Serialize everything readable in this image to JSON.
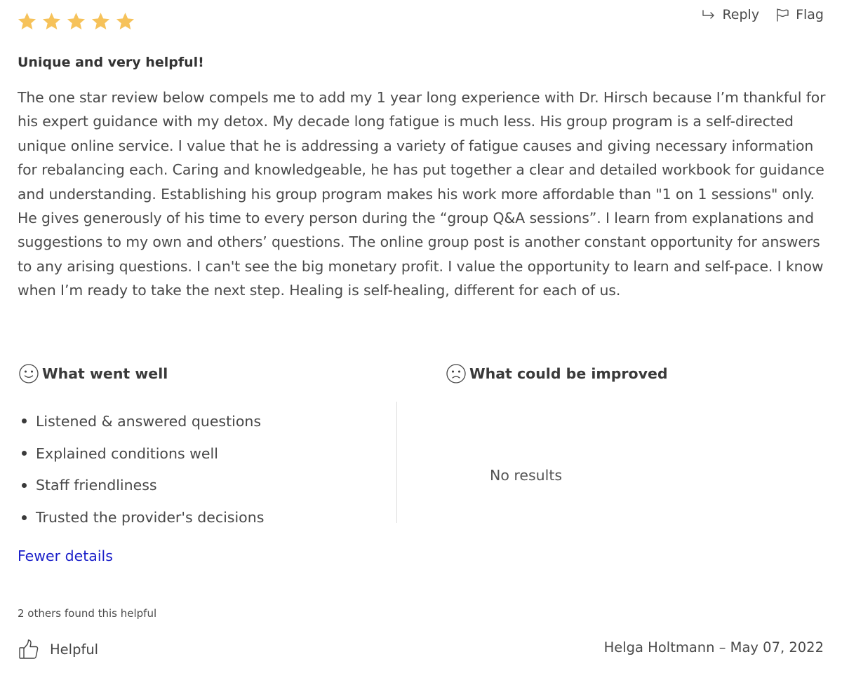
{
  "rating": {
    "value": 5,
    "max": 5,
    "color": "#f6c25a"
  },
  "actions": {
    "reply": "Reply",
    "flag": "Flag"
  },
  "review": {
    "title": "Unique and very helpful!",
    "body": "The one star review below compels me to add my 1 year long experience with Dr. Hirsch because I’m thankful for his expert guidance with my detox. My decade long fatigue is much less. His group program is a self-directed unique online service. I value that he is addressing a variety of fatigue causes and giving necessary information for rebalancing each. Caring and knowledgeable, he has put together a clear and detailed workbook for guidance and understanding. Establishing his group program makes his work more affordable than \"1 on 1 sessions\" only. He gives generously of his time to every person during the “group Q&A sessions”. I learn from explanations and suggestions to my own and others’ questions. The online group post is another constant opportunity for answers to any arising questions. I can't see the big monetary profit. I value the opportunity to learn and self-pace. I know when I’m ready to take the next step. Healing is self-healing, different for each of us."
  },
  "went_well": {
    "heading": "What went well",
    "items": [
      "Listened & answered questions",
      "Explained conditions well",
      "Staff friendliness",
      "Trusted the provider's decisions"
    ]
  },
  "could_improve": {
    "heading": "What could be improved",
    "empty_text": "No results"
  },
  "fewer_details": "Fewer details",
  "link_color": "#1a1fc9",
  "helpful": {
    "count_text": "2 others found this helpful",
    "button_label": "Helpful"
  },
  "author_line": "Helga Holtmann – May 07, 2022"
}
